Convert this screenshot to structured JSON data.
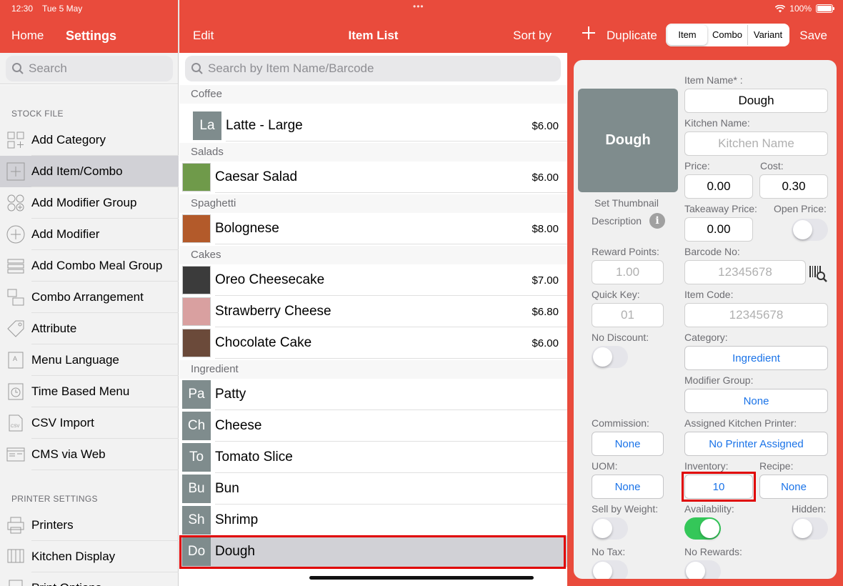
{
  "status": {
    "time": "12:30",
    "date": "Tue 5 May",
    "battery": "100%"
  },
  "sidebar": {
    "home": "Home",
    "title": "Settings",
    "search_placeholder": "Search",
    "section_stock": "STOCK FILE",
    "items": [
      {
        "label": "Add Category",
        "icon": "grid-plus-icon"
      },
      {
        "label": "Add Item/Combo",
        "icon": "plus-box-icon"
      },
      {
        "label": "Add Modifier Group",
        "icon": "circles-plus-icon"
      },
      {
        "label": "Add Modifier",
        "icon": "plus-circle-icon"
      },
      {
        "label": "Add Combo Meal Group",
        "icon": "stack-icon"
      },
      {
        "label": "Combo Arrangement",
        "icon": "arrange-icon"
      },
      {
        "label": "Attribute",
        "icon": "tag-icon"
      },
      {
        "label": "Menu Language",
        "icon": "language-icon"
      },
      {
        "label": "Time Based Menu",
        "icon": "clock-icon"
      },
      {
        "label": "CSV Import",
        "icon": "csv-icon"
      },
      {
        "label": "CMS via Web",
        "icon": "web-icon"
      }
    ],
    "section_printer": "PRINTER SETTINGS",
    "printer_items": [
      {
        "label": "Printers",
        "icon": "printer-icon"
      },
      {
        "label": "Kitchen Display",
        "icon": "kitchen-display-icon"
      },
      {
        "label": "Print Options",
        "icon": "print-options-icon"
      }
    ]
  },
  "list": {
    "edit": "Edit",
    "title": "Item List",
    "sort": "Sort by",
    "search_placeholder": "Search by Item Name/Barcode",
    "groups": {
      "coffee": "Coffee",
      "salads": "Salads",
      "spaghetti": "Spaghetti",
      "cakes": "Cakes",
      "ingredient": "Ingredient"
    },
    "items": [
      {
        "abbr": "La",
        "name": "Latte - Large",
        "price": "$6.00"
      },
      {
        "name": "Caesar Salad",
        "price": "$6.00"
      },
      {
        "name": "Bolognese",
        "price": "$8.00"
      },
      {
        "name": "Oreo Cheesecake",
        "price": "$7.00"
      },
      {
        "name": "Strawberry Cheese",
        "price": "$6.80"
      },
      {
        "name": "Chocolate Cake",
        "price": "$6.00"
      },
      {
        "abbr": "Pa",
        "name": "Patty"
      },
      {
        "abbr": "Ch",
        "name": "Cheese"
      },
      {
        "abbr": "To",
        "name": "Tomato Slice"
      },
      {
        "abbr": "Bu",
        "name": "Bun"
      },
      {
        "abbr": "Sh",
        "name": "Shrimp"
      },
      {
        "abbr": "Do",
        "name": "Dough"
      }
    ]
  },
  "detail": {
    "duplicate": "Duplicate",
    "save": "Save",
    "tabs": [
      "Item",
      "Combo",
      "Variant"
    ],
    "thumb_text": "Dough",
    "set_thumbnail": "Set Thumbnail",
    "description": "Description",
    "item_name_label": "Item Name* :",
    "item_name": "Dough",
    "kitchen_name_label": "Kitchen Name:",
    "kitchen_name_placeholder": "Kitchen Name",
    "price_label": "Price:",
    "price": "0.00",
    "cost_label": "Cost:",
    "cost": "0.30",
    "takeaway_label": "Takeaway Price:",
    "takeaway": "0.00",
    "open_price_label": "Open Price:",
    "open_price_on": false,
    "reward_label": "Reward Points:",
    "reward": "1.00",
    "barcode_label": "Barcode No:",
    "barcode": "12345678",
    "quick_key_label": "Quick Key:",
    "quick_key": "01",
    "item_code_label": "Item Code:",
    "item_code": "12345678",
    "no_discount_label": "No Discount:",
    "no_discount_on": false,
    "category_label": "Category:",
    "category": "Ingredient",
    "modifier_group_label": "Modifier Group:",
    "modifier_group": "None",
    "commission_label": "Commission:",
    "commission": "None",
    "kitchen_printer_label": "Assigned Kitchen Printer:",
    "kitchen_printer": "No Printer Assigned",
    "uom_label": "UOM:",
    "uom": "None",
    "inventory_label": "Inventory:",
    "inventory": "10",
    "recipe_label": "Recipe:",
    "recipe": "None",
    "sell_weight_label": "Sell by Weight:",
    "sell_weight_on": false,
    "availability_label": "Availability:",
    "availability_on": true,
    "hidden_label": "Hidden:",
    "hidden_on": false,
    "no_tax_label": "No Tax:",
    "no_rewards_label": "No Rewards:"
  },
  "colors": {
    "brand": "#e94b3c",
    "link": "#1a73e8",
    "toggle_on": "#34c759",
    "highlight": "#e00000"
  }
}
